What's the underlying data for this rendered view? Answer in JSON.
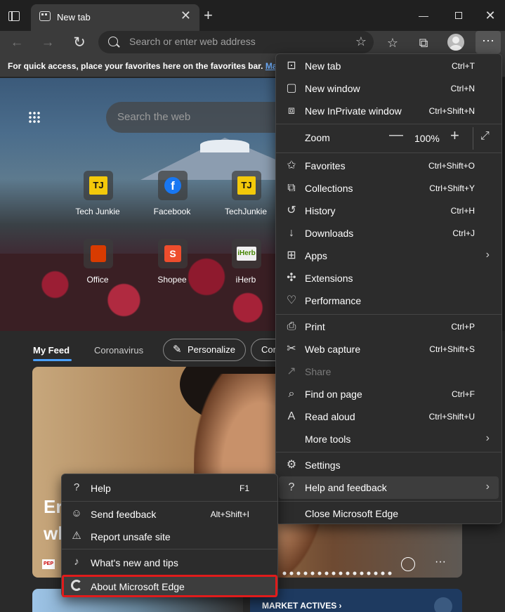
{
  "titlebar": {
    "tab_title": "New tab",
    "tab_close": "✕",
    "new_tab": "+",
    "minimize": "—",
    "close": "✕"
  },
  "toolbar": {
    "back": "←",
    "forward": "→",
    "refresh": "↻",
    "address_placeholder": "Search or enter web address",
    "add_favorite": "☆",
    "favorites": "☆",
    "collections": "⧉",
    "more": "···"
  },
  "favbar": {
    "text": "For quick access, place your favorites here on the favorites bar. ",
    "link": "Manag"
  },
  "newtab": {
    "search_placeholder": "Search the web",
    "tiles": [
      {
        "label": "Tech Junkie",
        "logo": "TJ"
      },
      {
        "label": "Facebook",
        "logo": "f"
      },
      {
        "label": "TechJunkie",
        "logo": "TJ"
      },
      {
        "label": "Office",
        "logo": ""
      },
      {
        "label": "Shopee",
        "logo": "S"
      },
      {
        "label": "iHerb",
        "logo": "iHerb"
      }
    ],
    "feed_tabs": [
      "My Feed",
      "Coronavirus"
    ],
    "personalize": "Personalize",
    "pill_more": "Con",
    "card_title_line1": "Er",
    "card_title_line2": "wl",
    "card_source": "PEP",
    "card_more": "···",
    "market_label": "MARKET ACTIVES ›"
  },
  "menu": {
    "items": [
      {
        "label": "New tab",
        "shortcut": "Ctrl+T",
        "icon": "new-tab-icon",
        "glyph": "⊡"
      },
      {
        "label": "New window",
        "shortcut": "Ctrl+N",
        "icon": "new-window-icon",
        "glyph": "▢"
      },
      {
        "label": "New InPrivate window",
        "shortcut": "Ctrl+Shift+N",
        "icon": "inprivate-icon",
        "glyph": "⧈"
      },
      {
        "label": "Favorites",
        "shortcut": "Ctrl+Shift+O",
        "icon": "favorites-icon",
        "glyph": "✩"
      },
      {
        "label": "Collections",
        "shortcut": "Ctrl+Shift+Y",
        "icon": "collections-icon",
        "glyph": "⧉"
      },
      {
        "label": "History",
        "shortcut": "Ctrl+H",
        "icon": "history-icon",
        "glyph": "↺"
      },
      {
        "label": "Downloads",
        "shortcut": "Ctrl+J",
        "icon": "downloads-icon",
        "glyph": "↓"
      },
      {
        "label": "Apps",
        "shortcut": "",
        "icon": "apps-icon",
        "glyph": "⊞",
        "arrow": "›"
      },
      {
        "label": "Extensions",
        "shortcut": "",
        "icon": "extensions-icon",
        "glyph": "✣"
      },
      {
        "label": "Performance",
        "shortcut": "",
        "icon": "performance-icon",
        "glyph": "♡"
      },
      {
        "label": "Print",
        "shortcut": "Ctrl+P",
        "icon": "print-icon",
        "glyph": "⎙"
      },
      {
        "label": "Web capture",
        "shortcut": "Ctrl+Shift+S",
        "icon": "web-capture-icon",
        "glyph": "✂"
      },
      {
        "label": "Share",
        "shortcut": "",
        "icon": "share-icon",
        "glyph": "↗"
      },
      {
        "label": "Find on page",
        "shortcut": "Ctrl+F",
        "icon": "find-icon",
        "glyph": "⌕"
      },
      {
        "label": "Read aloud",
        "shortcut": "Ctrl+Shift+U",
        "icon": "read-aloud-icon",
        "glyph": "A"
      },
      {
        "label": "More tools",
        "shortcut": "",
        "icon": "",
        "glyph": "",
        "arrow": "›"
      },
      {
        "label": "Settings",
        "shortcut": "",
        "icon": "settings-icon",
        "glyph": "⚙"
      },
      {
        "label": "Help and feedback",
        "shortcut": "",
        "icon": "help-icon",
        "glyph": "?",
        "arrow": "›"
      },
      {
        "label": "Close Microsoft Edge",
        "shortcut": "",
        "icon": "",
        "glyph": ""
      }
    ],
    "zoom": {
      "label": "Zoom",
      "minus": "—",
      "value": "100%",
      "plus": "+",
      "fullscreen": "⤢"
    }
  },
  "submenu": {
    "items": [
      {
        "label": "Help",
        "shortcut": "F1",
        "glyph": "?"
      },
      {
        "label": "Send feedback",
        "shortcut": "Alt+Shift+I",
        "glyph": "☺"
      },
      {
        "label": "Report unsafe site",
        "shortcut": "",
        "glyph": "⚠"
      },
      {
        "label": "What's new and tips",
        "shortcut": "",
        "glyph": "♪"
      },
      {
        "label": "About Microsoft Edge",
        "shortcut": "",
        "glyph": ""
      }
    ]
  },
  "colors": {
    "menu_bg": "#2c2c2c",
    "highlight_border": "#e01b1b",
    "link": "#6fb0ff",
    "feed_underline": "#4aa0ff"
  }
}
